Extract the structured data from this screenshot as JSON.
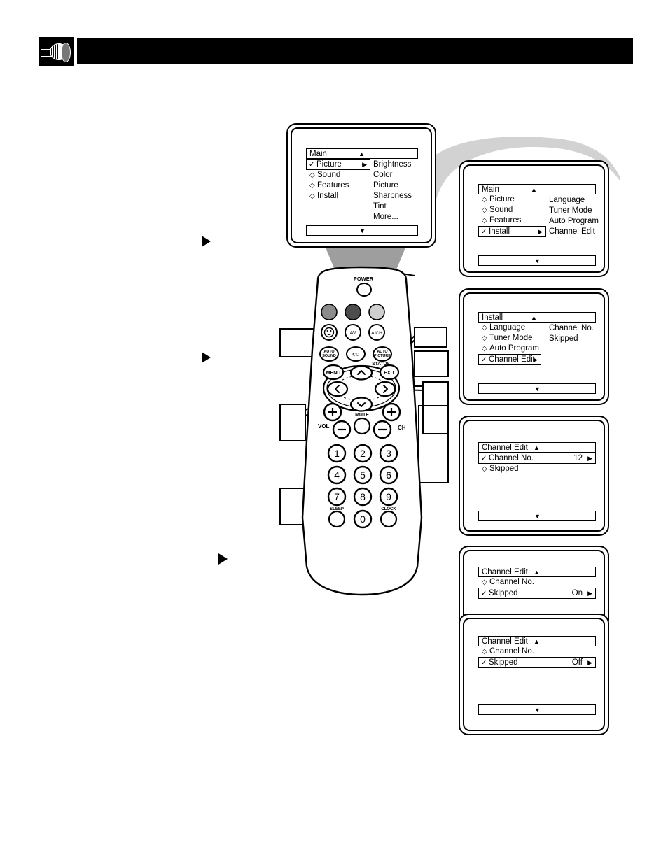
{
  "header": {
    "title": "",
    "icon": "coaxial-cable-connector-icon",
    "bar_color": "#000000"
  },
  "steps": [
    {
      "marker": "solid-right-triangle",
      "text": ""
    },
    {
      "marker": "solid-right-triangle",
      "text": ""
    },
    {
      "marker": "solid-right-triangle",
      "text": ""
    }
  ],
  "tv_screen": {
    "name": "tv-screen-main-menu",
    "menu": {
      "title": "Main",
      "up_arrow": "▲",
      "down_arrow": "▼",
      "left_column": [
        {
          "mark": "✓",
          "label": "Picture",
          "selected": true,
          "arrow": "▶"
        },
        {
          "mark": "◇",
          "label": "Sound",
          "selected": false,
          "arrow": ""
        },
        {
          "mark": "◇",
          "label": "Features",
          "selected": false,
          "arrow": ""
        },
        {
          "mark": "◇",
          "label": "Install",
          "selected": false,
          "arrow": ""
        }
      ],
      "right_column": [
        "Brightness",
        "Color",
        "Picture",
        "Sharpness",
        "Tint",
        "More..."
      ]
    }
  },
  "panels": [
    {
      "name": "panel-main-install-selected",
      "menu": {
        "title": "Main",
        "up_arrow": "▲",
        "down_arrow": "▼",
        "left_column": [
          {
            "mark": "◇",
            "label": "Picture",
            "selected": false,
            "arrow": ""
          },
          {
            "mark": "◇",
            "label": "Sound",
            "selected": false,
            "arrow": ""
          },
          {
            "mark": "◇",
            "label": "Features",
            "selected": false,
            "arrow": ""
          },
          {
            "mark": "✓",
            "label": "Install",
            "selected": true,
            "arrow": "▶"
          }
        ],
        "right_column": [
          "Language",
          "Tuner Mode",
          "Auto Program",
          "Channel Edit"
        ]
      }
    },
    {
      "name": "panel-install-channel-edit-selected",
      "menu": {
        "title": "Install",
        "up_arrow": "▲",
        "down_arrow": "▼",
        "left_column": [
          {
            "mark": "◇",
            "label": "Language",
            "selected": false,
            "arrow": ""
          },
          {
            "mark": "◇",
            "label": "Tuner Mode",
            "selected": false,
            "arrow": ""
          },
          {
            "mark": "◇",
            "label": "Auto Program",
            "selected": false,
            "arrow": ""
          },
          {
            "mark": "✓",
            "label": "Channel Edit",
            "selected": true,
            "arrow": "▶"
          }
        ],
        "right_column": [
          "Channel No.",
          "Skipped"
        ]
      }
    },
    {
      "name": "panel-channel-edit-channel-no",
      "menu": {
        "title": "Channel Edit",
        "up_arrow": "▲",
        "down_arrow": "▼",
        "left_column": [
          {
            "mark": "✓",
            "label": "Channel No.",
            "selected": true,
            "arrow": "▶",
            "value": "12"
          },
          {
            "mark": "◇",
            "label": "Skipped",
            "selected": false,
            "arrow": "",
            "value": ""
          }
        ],
        "right_column": []
      }
    },
    {
      "name": "panel-channel-edit-skipped-on",
      "menu": {
        "title": "Channel Edit",
        "up_arrow": "▲",
        "down_arrow": "",
        "left_column": [
          {
            "mark": "◇",
            "label": "Channel No.",
            "selected": false,
            "arrow": "",
            "value": ""
          },
          {
            "mark": "✓",
            "label": "Skipped",
            "selected": true,
            "arrow": "▶",
            "value": "On"
          }
        ],
        "right_column": []
      }
    },
    {
      "name": "panel-channel-edit-skipped-off",
      "menu": {
        "title": "Channel Edit",
        "up_arrow": "▲",
        "down_arrow": "▼",
        "left_column": [
          {
            "mark": "◇",
            "label": "Channel No.",
            "selected": false,
            "arrow": "",
            "value": ""
          },
          {
            "mark": "✓",
            "label": "Skipped",
            "selected": true,
            "arrow": "▶",
            "value": "Off"
          }
        ],
        "right_column": []
      }
    }
  ],
  "remote": {
    "name": "tv-remote-control",
    "labels": {
      "power": "POWER",
      "av": "AV",
      "a_ch": "A/CH",
      "auto_sound": "AUTO\nSOUND",
      "cc": "CC",
      "auto_picture": "AUTO\nPICTURE",
      "status": "STATUS",
      "menu": "MENU",
      "exit": "EXIT",
      "mute": "MUTE",
      "vol": "VOL",
      "ch": "CH",
      "plus": "+",
      "minus": "−",
      "sleep": "SLEEP",
      "clock": "CLOCK",
      "up": "⌃",
      "down": "⌄",
      "left": "‹",
      "right": "›",
      "smiley": "☺"
    },
    "keypad": [
      "1",
      "2",
      "3",
      "4",
      "5",
      "6",
      "7",
      "8",
      "9",
      "0"
    ],
    "color_buttons": [
      "#8c8c8c",
      "#4d4d4d",
      "#cfcfcf"
    ]
  },
  "colors": {
    "swoosh_gray": "#d2d2d2",
    "shadow_gray": "#9e9e9e",
    "ink": "#000000"
  }
}
